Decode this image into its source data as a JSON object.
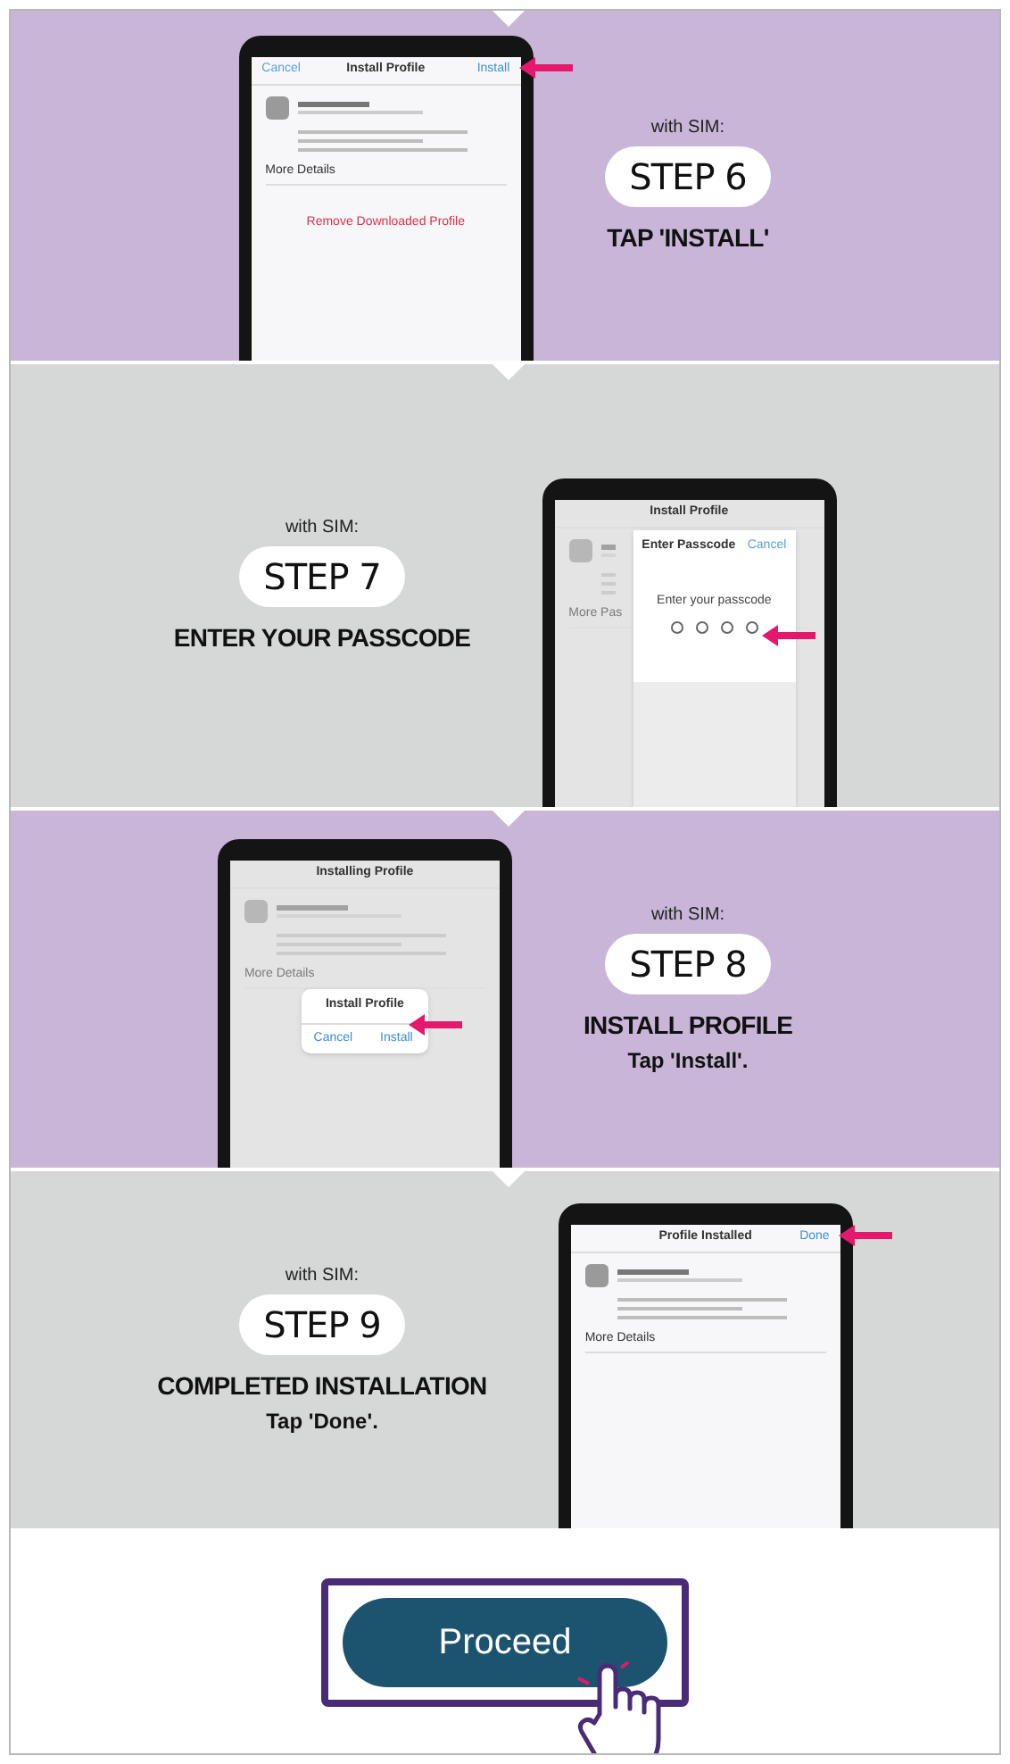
{
  "steps": [
    {
      "with_sim": "with SIM:",
      "step": "STEP 6",
      "title": "TAP 'INSTALL'",
      "screen": {
        "kind": "profile",
        "header_left": "Cancel",
        "title": "Install Profile",
        "header_right": "Install",
        "details": "More Details",
        "remove": "Remove Downloaded Profile"
      }
    },
    {
      "with_sim": "with SIM:",
      "step": "STEP 7",
      "title": "ENTER YOUR PASSCODE",
      "screen": {
        "kind": "passcode",
        "title": "Install Profile",
        "details": "More Pas",
        "modal": {
          "title": "Enter Passcode",
          "cancel": "Cancel",
          "prompt": "Enter your passcode",
          "pins": [
            {
              "filled": false
            },
            {
              "filled": false
            },
            {
              "filled": false
            },
            {
              "filled": false
            }
          ]
        }
      }
    },
    {
      "with_sim": "with SIM:",
      "step": "STEP 8",
      "title": "INSTALL PROFILE",
      "subtitle": "Tap 'Install'.",
      "screen": {
        "kind": "alert",
        "title": "Installing Profile",
        "details": "More Details",
        "alert": {
          "title": "Install Profile",
          "buttons": [
            "Cancel",
            "Install"
          ]
        }
      }
    },
    {
      "with_sim": "with SIM:",
      "step": "STEP 9",
      "title": "COMPLETED INSTALLATION",
      "subtitle": "Tap 'Done'.",
      "screen": {
        "kind": "profile",
        "title": "Profile Installed",
        "header_right": "Done",
        "details": "More Details"
      }
    }
  ],
  "proceed": {
    "label": "Proceed"
  }
}
